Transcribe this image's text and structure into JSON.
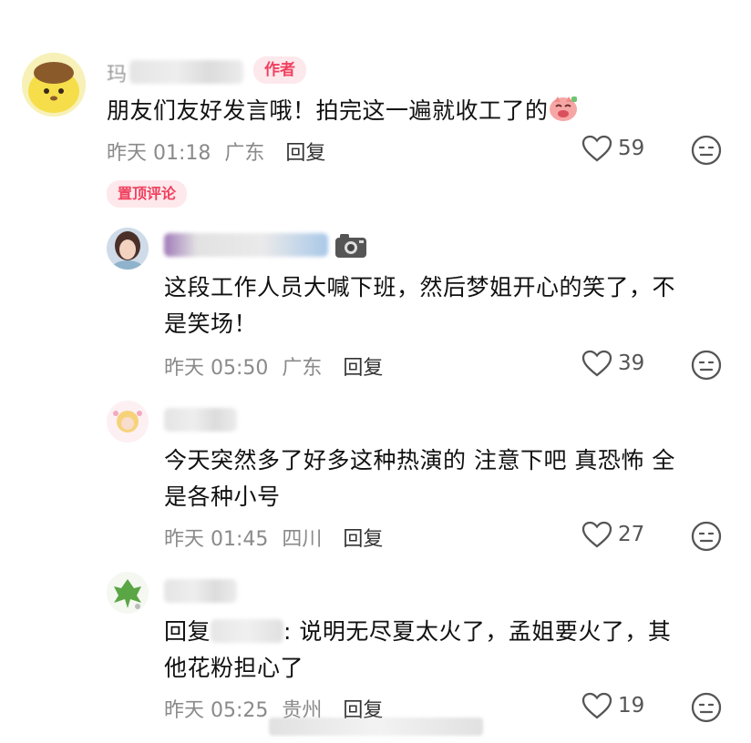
{
  "comments": [
    {
      "name_prefix": "玛",
      "badge": "作者",
      "text": "朋友们友好发言哦！拍完这一遍就收工了的",
      "time": "昨天 01:18",
      "location": "广东",
      "reply_label": "回复",
      "likes": "59",
      "pinned_label": "置顶评论"
    },
    {
      "text_line1": "这段工作人员大喊下班，然后梦姐开心的笑了，不",
      "text_line2": "是笑场！",
      "time": "昨天 05:50",
      "location": "广东",
      "reply_label": "回复",
      "likes": "39"
    },
    {
      "text_line1": "今天突然多了好多这种热演的 注意下吧 真恐怖 全",
      "text_line2": "是各种小号",
      "time": "昨天 01:45",
      "location": "四川",
      "reply_label": "回复",
      "likes": "27"
    },
    {
      "reply_prefix": "回复",
      "text_line1": ": 说明无尽夏太火了，孟姐要火了，其",
      "text_line2": "他花粉担心了",
      "time": "昨天 05:25",
      "location": "贵州",
      "reply_label": "回复",
      "likes": "19"
    }
  ],
  "colors": {
    "accent": "#f0405e",
    "badge_bg": "#fde8ec",
    "meta_text": "#8a8a8a"
  },
  "icons": [
    "heart-icon",
    "emoji-face-icon",
    "camera-icon"
  ]
}
